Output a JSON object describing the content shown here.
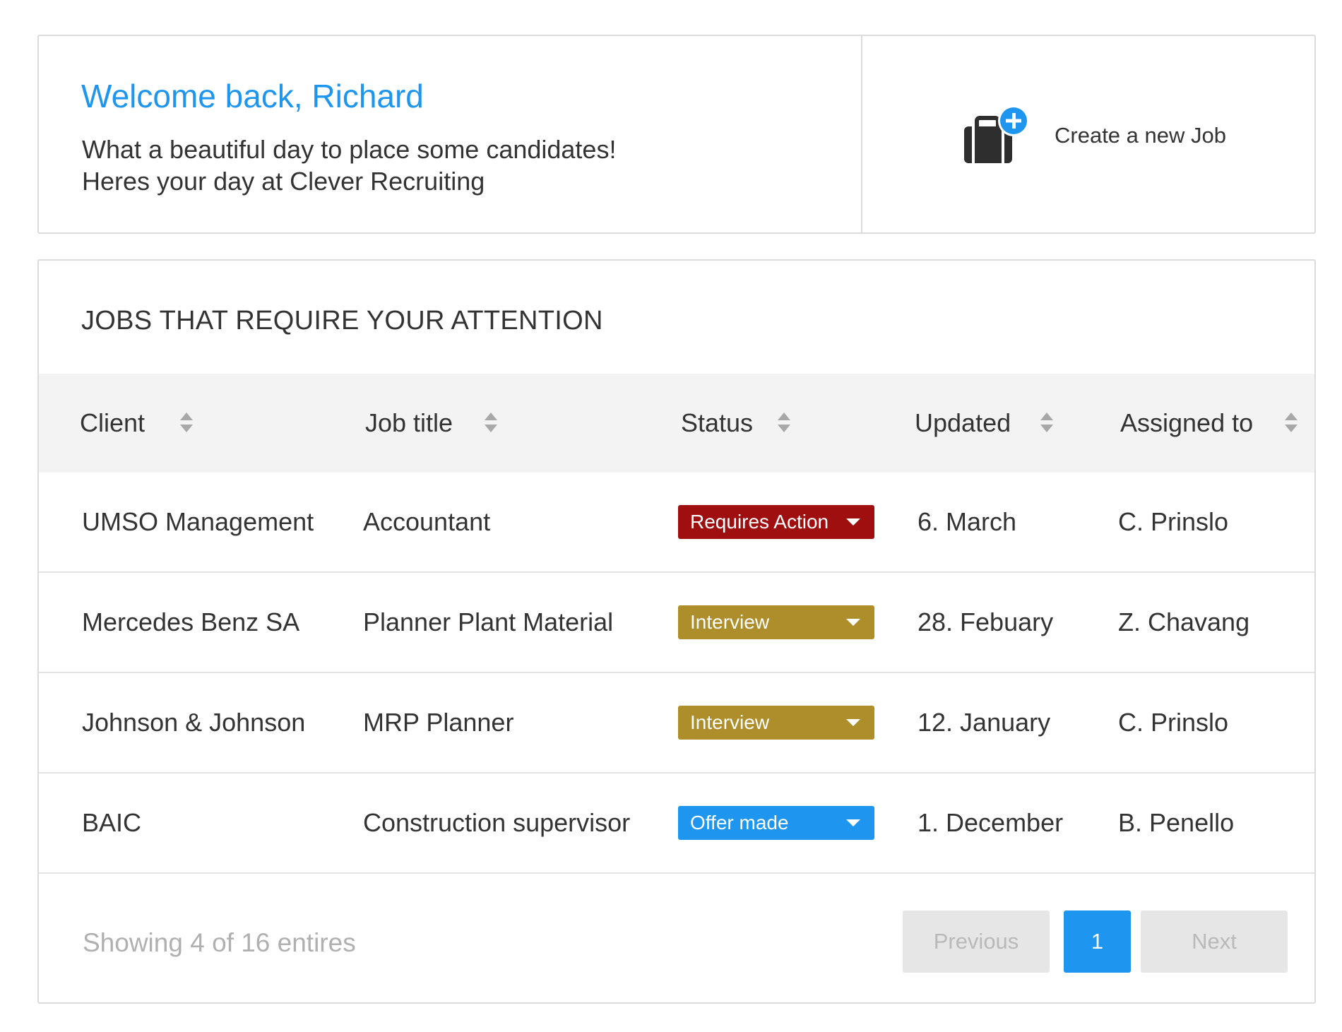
{
  "welcome": {
    "title": "Welcome back, Richard",
    "line1": "What a beautiful day to place some candidates!",
    "line2": "Heres your day at Clever Recruiting",
    "create_job_label": "Create a new Job"
  },
  "jobs": {
    "title": "JOBS THAT REQUIRE YOUR ATTENTION",
    "columns": [
      "Client",
      "Job title",
      "Status",
      "Updated",
      "Assigned to"
    ],
    "rows": [
      {
        "client": "UMSO Management",
        "job_title": "Accountant",
        "status": "Requires Action",
        "status_color": "#a00f0f",
        "updated": "6. March",
        "assigned_to": "C. Prinslo"
      },
      {
        "client": "Mercedes Benz SA",
        "job_title": "Planner Plant Material",
        "status": "Interview",
        "status_color": "#ad8e2b",
        "updated": "28. Febuary",
        "assigned_to": "Z. Chavang"
      },
      {
        "client": "Johnson & Johnson",
        "job_title": "MRP Planner",
        "status": "Interview",
        "status_color": "#ad8e2b",
        "updated": "12. January",
        "assigned_to": "C. Prinslo"
      },
      {
        "client": "BAIC",
        "job_title": "Construction supervisor",
        "status": "Offer made",
        "status_color": "#1e96f0",
        "updated": "1. December",
        "assigned_to": "B. Penello"
      }
    ],
    "footer_info": "Showing 4 of 16 entires",
    "pagination": {
      "previous": "Previous",
      "current": "1",
      "next": "Next"
    }
  },
  "colors": {
    "accent": "#1e96f0",
    "requires_action": "#a00f0f",
    "interview": "#ad8e2b",
    "offer_made": "#1e96f0"
  },
  "icons": {
    "create_job": "briefcase-plus-icon",
    "sort": "sort-arrows-icon",
    "status_dropdown": "caret-down-icon"
  }
}
